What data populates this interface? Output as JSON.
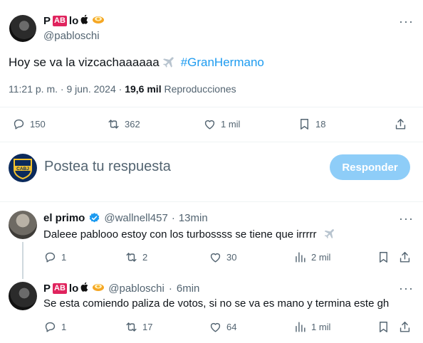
{
  "main_tweet": {
    "author_name_prefix": "P",
    "author_badge": "AB",
    "author_name_suffix": "lo",
    "handle": "@pabloschi",
    "text": "Hoy se va la vizcachaaaaaa",
    "hashtag": "#GranHermano",
    "time": "11:21 p. m.",
    "date_sep": "·",
    "date": "9 jun. 2024",
    "views_sep": "·",
    "views_count": "19,6 mil",
    "views_label": "Reproducciones",
    "stats": {
      "replies": "150",
      "reposts": "362",
      "likes": "1 mil",
      "bookmarks": "18"
    }
  },
  "compose": {
    "placeholder": "Postea tu respuesta",
    "reply_button": "Responder"
  },
  "replies": [
    {
      "name": "el primo",
      "handle": "@wallnell457",
      "time_sep": "·",
      "time": "13min",
      "text": "Daleee pablooo estoy con los turbossss se tiene que irrrrr",
      "stats": {
        "replies": "1",
        "reposts": "2",
        "likes": "30",
        "views": "2 mil"
      }
    },
    {
      "name_prefix": "P",
      "name_badge": "AB",
      "name_suffix": "lo",
      "handle": "@pabloschi",
      "time_sep": "·",
      "time": "6min",
      "text": "Se esta comiendo paliza de votos, si no se va es mano y termina este gh",
      "stats": {
        "replies": "1",
        "reposts": "17",
        "likes": "64",
        "views": "1 mil"
      }
    }
  ],
  "colors": {
    "accent": "#1d9bf0",
    "button_disabled": "#8ecdf8",
    "muted": "#536471",
    "badge": "#e0245e"
  },
  "icons": [
    "more-icon",
    "reply-icon",
    "repost-icon",
    "like-icon",
    "bookmark-icon",
    "share-icon",
    "views-icon",
    "verified-icon",
    "airplane-icon",
    "apple-icon",
    "egg-icon"
  ]
}
